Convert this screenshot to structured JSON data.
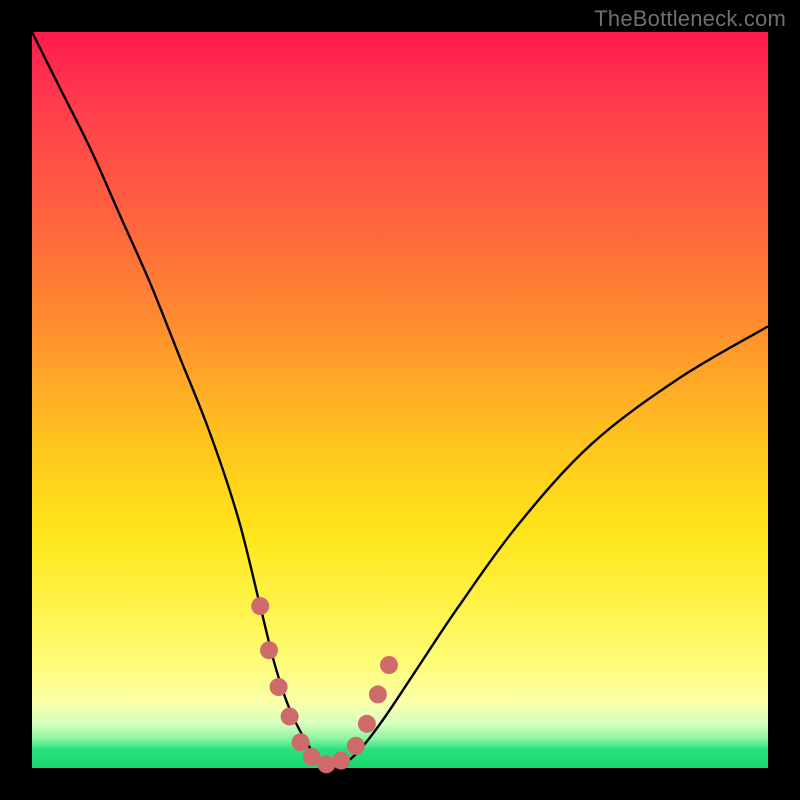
{
  "watermark": "TheBottleneck.com",
  "chart_data": {
    "type": "line",
    "title": "",
    "xlabel": "",
    "ylabel": "",
    "xlim": [
      0,
      100
    ],
    "ylim": [
      0,
      100
    ],
    "series": [
      {
        "name": "bottleneck-curve",
        "x": [
          0,
          4,
          8,
          12,
          16,
          20,
          24,
          28,
          31,
          33,
          35,
          37,
          39,
          41,
          43,
          45,
          48,
          52,
          58,
          66,
          76,
          88,
          100
        ],
        "y": [
          100,
          92,
          84,
          75,
          66,
          56,
          46,
          34,
          22,
          14,
          8,
          4,
          1,
          0,
          1,
          3,
          7,
          13,
          22,
          33,
          44,
          53,
          60
        ]
      }
    ],
    "markers": {
      "name": "highlight-dots",
      "color": "#cf6a6a",
      "x": [
        31.0,
        32.2,
        33.5,
        35.0,
        36.5,
        38.0,
        40.0,
        42.0,
        44.0,
        45.5,
        47.0,
        48.5
      ],
      "y": [
        22.0,
        16.0,
        11.0,
        7.0,
        3.5,
        1.5,
        0.5,
        1.0,
        3.0,
        6.0,
        10.0,
        14.0
      ]
    },
    "background_gradient": {
      "top": "#ff1a4d",
      "mid": "#ffe519",
      "bottom": "#17d96f"
    }
  }
}
